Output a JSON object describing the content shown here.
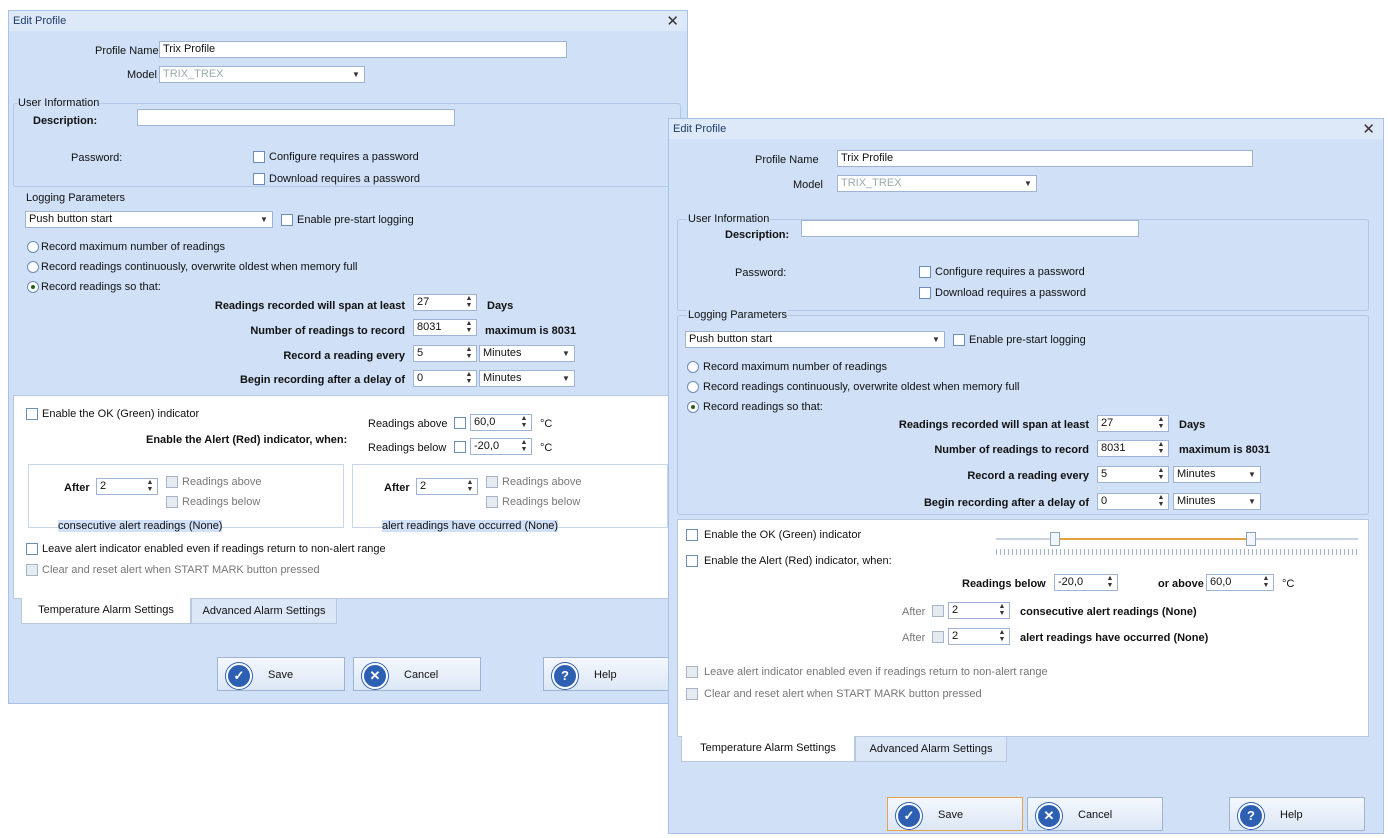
{
  "dialog_left": {
    "title": "Edit Profile",
    "close_glyph": "✕",
    "profile_name_label": "Profile Name",
    "profile_name_value": "Trix Profile",
    "model_label": "Model",
    "model_value": "TRIX_TREX",
    "user_info_label": "User Information",
    "description_label": "Description:",
    "password_label": "Password:",
    "configure_pw_label": "Configure requires a password",
    "download_pw_label": "Download requires a password",
    "logging_label": "Logging Parameters",
    "start_mode": "Push button start",
    "prestart_label": "Enable pre-start logging",
    "radio_max": "Record maximum number of readings",
    "radio_cont": "Record readings continuously, overwrite oldest when memory full",
    "radio_so": "Record readings so that:",
    "span_label": "Readings recorded will span at least",
    "span_value": "27",
    "span_unit": "Days",
    "num_label": "Number of readings to record",
    "num_value": "8031",
    "num_max": "maximum is 8031",
    "every_label": "Record a reading every",
    "every_value": "5",
    "every_unit": "Minutes",
    "delay_label": "Begin recording after a delay of",
    "delay_value": "0",
    "delay_unit": "Minutes",
    "ok_indicator": "Enable the OK (Green) indicator",
    "alert_indicator": "Enable the Alert (Red) indicator, when:",
    "above_label": "Readings above",
    "above_value": "60,0",
    "below_label": "Readings below",
    "below_value": "-20,0",
    "temp_unit": "°C",
    "after_label": "After",
    "after1_value": "2",
    "after2_value": "2",
    "g1_above": "Readings above",
    "g1_below": "Readings below",
    "g2_above": "Readings above",
    "g2_below": "Readings below",
    "consecutive_text": "consecutive alert readings (None)",
    "occurred_text": "alert readings have occurred (None)",
    "leave_enabled": "Leave alert indicator enabled even if readings return to non-alert range",
    "clear_reset": "Clear and reset alert when START MARK button pressed",
    "tab_temp": "Temperature Alarm Settings",
    "tab_adv": "Advanced Alarm Settings",
    "save": "Save",
    "cancel": "Cancel",
    "help": "Help"
  },
  "dialog_right": {
    "title": "Edit Profile",
    "close_glyph": "✕",
    "profile_name_label": "Profile Name",
    "profile_name_value": "Trix Profile",
    "model_label": "Model",
    "model_value": "TRIX_TREX",
    "user_info_label": "User Information",
    "description_label": "Description:",
    "password_label": "Password:",
    "configure_pw_label": "Configure requires a password",
    "download_pw_label": "Download requires a password",
    "logging_label": "Logging Parameters",
    "start_mode": "Push button start",
    "prestart_label": "Enable pre-start logging",
    "radio_max": "Record maximum number of readings",
    "radio_cont": "Record readings continuously, overwrite oldest when memory full",
    "radio_so": "Record readings so that:",
    "span_label": "Readings recorded will span at least",
    "span_value": "27",
    "span_unit": "Days",
    "num_label": "Number of readings to record",
    "num_value": "8031",
    "num_max": "maximum is 8031",
    "every_label": "Record a reading every",
    "every_value": "5",
    "every_unit": "Minutes",
    "delay_label": "Begin recording after a delay of",
    "delay_value": "0",
    "delay_unit": "Minutes",
    "ok_indicator": "Enable the OK (Green) indicator",
    "alert_indicator": "Enable the Alert (Red) indicator, when:",
    "below_label": "Readings below",
    "below_value": "-20,0",
    "above_label": "or above",
    "above_value": "60,0",
    "temp_unit": "°C",
    "after_label": "After",
    "after1_value": "2",
    "after2_value": "2",
    "consecutive_text": "consecutive alert readings (None)",
    "occurred_text": "alert readings have occurred (None)",
    "leave_enabled": "Leave alert indicator enabled even if readings return to non-alert range",
    "clear_reset": "Clear and reset alert when START MARK button pressed",
    "tab_temp": "Temperature Alarm Settings",
    "tab_adv": "Advanced Alarm Settings",
    "save": "Save",
    "cancel": "Cancel",
    "help": "Help"
  },
  "icons": {
    "save": "✓",
    "cancel": "✕",
    "help": "?"
  }
}
